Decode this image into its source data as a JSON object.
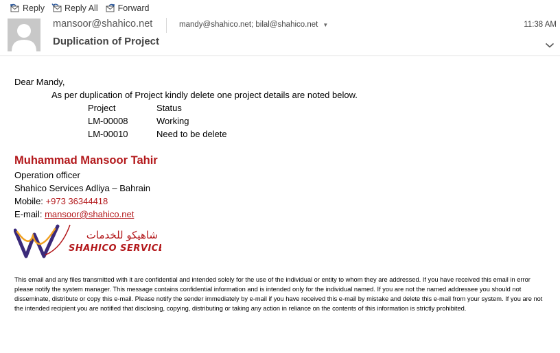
{
  "toolbar": {
    "reply_label": "Reply",
    "reply_all_label": "Reply All",
    "forward_label": "Forward"
  },
  "header": {
    "from": "mansoor@shahico.net",
    "recipients": "mandy@shahico.net; bilal@shahico.net",
    "time": "11:38 AM",
    "subject": "Duplication of Project"
  },
  "body": {
    "greeting": "Dear Mandy,",
    "intro": "As per duplication of Project kindly delete one project details are noted below.",
    "table_headers": [
      "Project",
      "Status"
    ],
    "rows": [
      [
        "LM-00008",
        "Working"
      ],
      [
        "LM-00010",
        "Need to be delete"
      ]
    ]
  },
  "signature": {
    "name": "Muhammad Mansoor Tahir",
    "title": "Operation officer",
    "company": "Shahico Services Adliya – Bahrain",
    "mobile_label": "Mobile: ",
    "mobile": "+973 36344418",
    "email_label": "E-mail: ",
    "email": "mansoor@shahico.net",
    "logo_arabic": "شاهيكو للخدمات",
    "logo_english": "SHAHICO SERVICES"
  },
  "disclaimer": "This email and any files transmitted with it are confidential and intended solely for the use of the individual or entity to whom they are addressed. If you have received this email in error please notify the system manager. This message contains confidential information and is intended only for the individual named. If you are not the named addressee you should not disseminate, distribute or copy this e-mail. Please notify the sender immediately by e-mail if you have received this e-mail by mistake and delete this e-mail from your system. If you are not the intended recipient you are notified that disclosing, copying, distributing or taking any action in reliance on the contents of this information is strictly prohibited.",
  "colors": {
    "signature_red": "#b3181b",
    "icon_blue": "#2b579a",
    "logo_purple": "#3b2a7a",
    "logo_orange": "#f0a020"
  }
}
